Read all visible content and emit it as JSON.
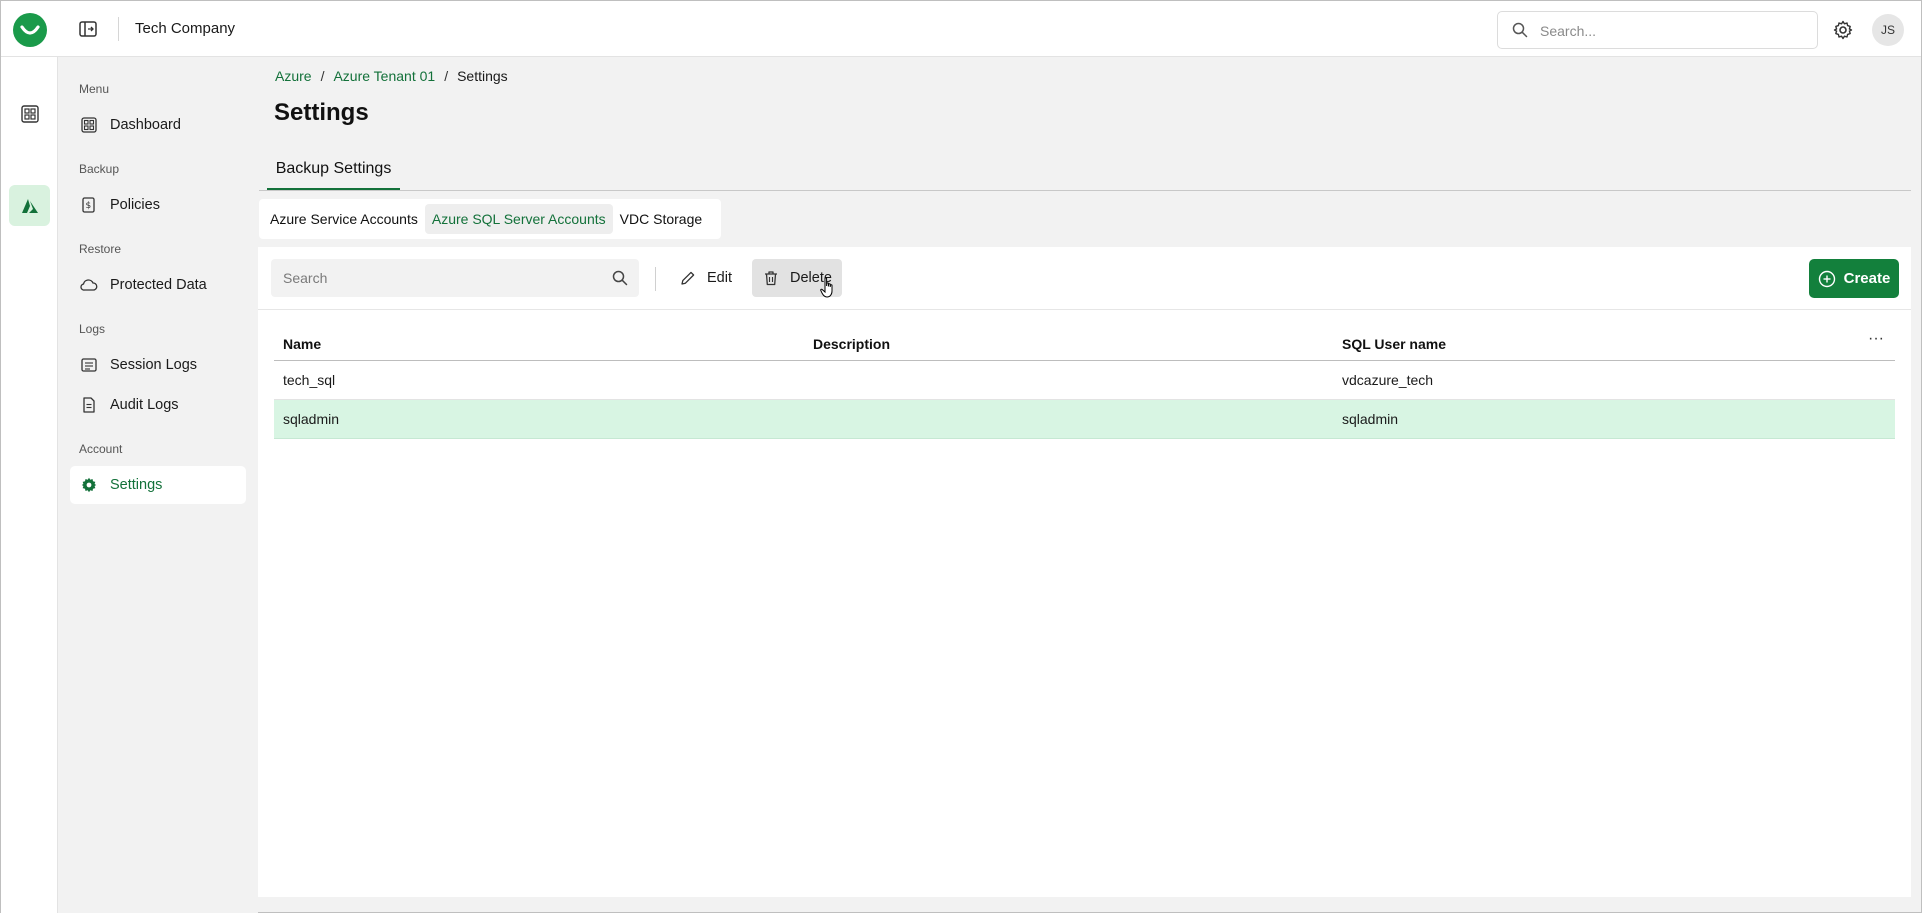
{
  "header": {
    "company": "Tech Company",
    "search_placeholder": "Search...",
    "avatar_initials": "JS"
  },
  "nav": {
    "sections": [
      {
        "label": "Menu",
        "items": [
          {
            "label": "Dashboard",
            "icon": "dashboard-icon"
          }
        ]
      },
      {
        "label": "Backup",
        "items": [
          {
            "label": "Policies",
            "icon": "policies-icon"
          }
        ]
      },
      {
        "label": "Restore",
        "items": [
          {
            "label": "Protected Data",
            "icon": "cloud-icon"
          }
        ]
      },
      {
        "label": "Logs",
        "items": [
          {
            "label": "Session Logs",
            "icon": "session-logs-icon"
          },
          {
            "label": "Audit Logs",
            "icon": "audit-logs-icon"
          }
        ]
      },
      {
        "label": "Account",
        "items": [
          {
            "label": "Settings",
            "icon": "gear-icon",
            "active": true
          }
        ]
      }
    ]
  },
  "breadcrumb": {
    "items": [
      "Azure",
      "Azure Tenant 01"
    ],
    "current": "Settings"
  },
  "page": {
    "title": "Settings",
    "tab": "Backup Settings",
    "subtabs": [
      "Azure Service Accounts",
      "Azure SQL Server Accounts",
      "VDC Storage"
    ],
    "active_subtab": "Azure SQL Server Accounts"
  },
  "toolbar": {
    "search_placeholder": "Search",
    "edit_label": "Edit",
    "delete_label": "Delete",
    "create_label": "Create"
  },
  "table": {
    "columns": [
      "Name",
      "Description",
      "SQL User name"
    ],
    "rows": [
      {
        "name": "tech_sql",
        "description": "",
        "sql_user": "vdcazure_tech",
        "selected": false
      },
      {
        "name": "sqladmin",
        "description": "",
        "sql_user": "sqladmin",
        "selected": true
      }
    ]
  },
  "colors": {
    "accent": "#13713a",
    "primary_button": "#13803c",
    "selected_row": "#d8f5e3"
  }
}
